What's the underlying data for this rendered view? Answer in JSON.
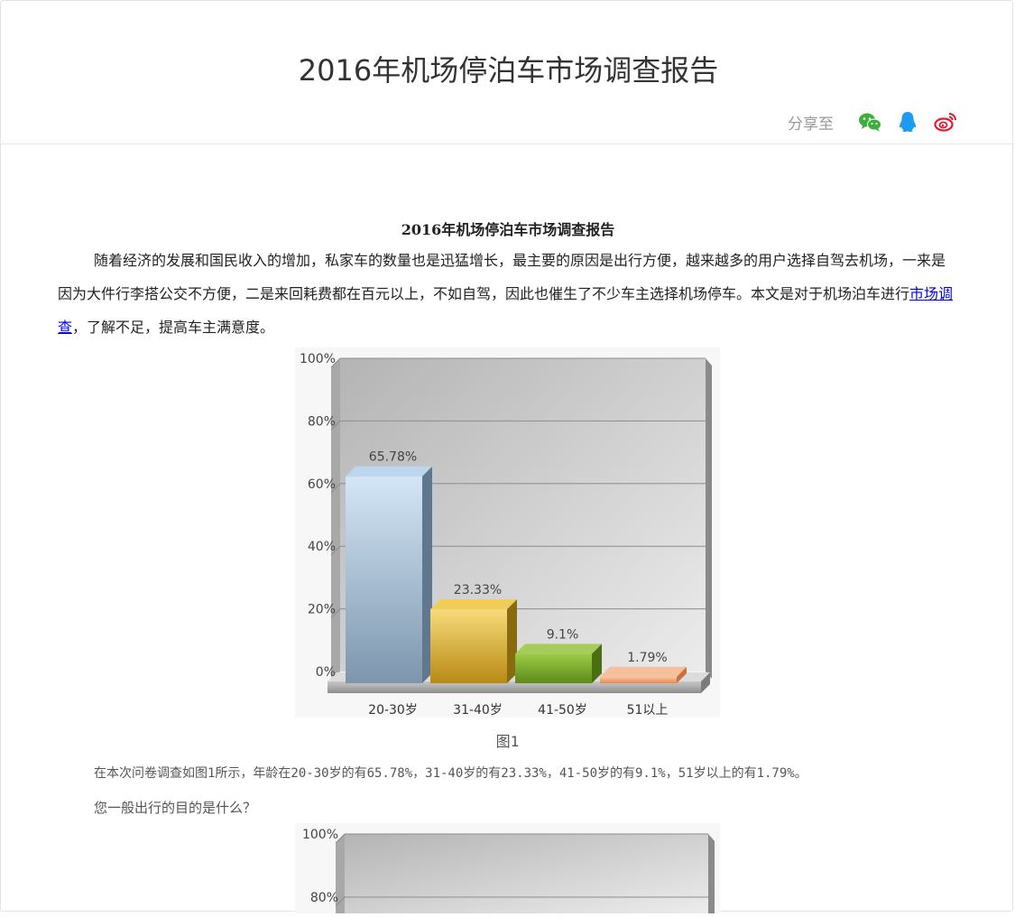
{
  "header": {
    "title": "2016年机场停泊车市场调查报告",
    "share_label": "分享至",
    "share_icons": [
      "wechat-icon",
      "qq-icon",
      "weibo-icon"
    ]
  },
  "article": {
    "title": "2016年机场停泊车市场调查报告",
    "intro_before_link": "随着经济的发展和国民收入的增加，私家车的数量也是迅猛增长，最主要的原因是出行方便，越来越多的用户选择自驾去机场，一来是因为大件行李搭公交不方便，二是来回耗费都在百元以上，不如自驾，因此也催生了不少车主选择机场停车。本文是对于机场泊车进行",
    "intro_link": "市场调查",
    "intro_after_link": "，了解不足，提高车主满意度。",
    "figure_caption": "图1",
    "para2": "在本次问卷调查如图1所示，年龄在20-30岁的有65.78%，31-40岁的有23.33%，41-50岁的有9.1%，51岁以上的有1.79%。",
    "para3": "您一般出行的目的是什么？"
  },
  "chart_data": [
    {
      "type": "bar",
      "categories": [
        "20-30岁",
        "31-40岁",
        "41-50岁",
        "51以上"
      ],
      "values": [
        65.78,
        23.33,
        9.1,
        1.79
      ],
      "value_labels": [
        "65.78%",
        "23.33%",
        "9.1%",
        "1.79%"
      ],
      "yticks": [
        "0%",
        "20%",
        "40%",
        "60%",
        "80%",
        "100%"
      ],
      "ylim": [
        0,
        100
      ],
      "grid": true,
      "colors": [
        "#8fb0cc",
        "#e2b83c",
        "#7fb02c",
        "#f0a070"
      ]
    },
    {
      "type": "bar",
      "yticks": [
        "100%",
        "80%"
      ],
      "ylim": [
        0,
        100
      ],
      "grid": true
    }
  ]
}
